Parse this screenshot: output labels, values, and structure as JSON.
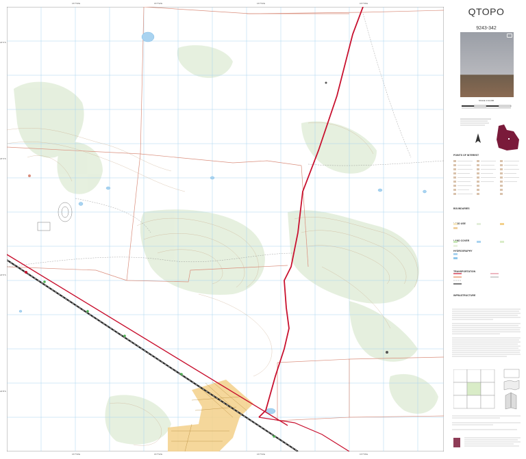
{
  "product_title": "QTOPO",
  "map_sheet_id": "9243-342",
  "scale_label": "SCALE 1:10,000",
  "sections": {
    "points_of_interest": "POINTS OF INTEREST",
    "boundaries": "BOUNDARIES",
    "land_use": "LAND USE",
    "land_cover": "LAND COVER",
    "hydrography": "HYDROGRAPHY",
    "transportation": "TRANSPORTATION",
    "infrastructure": "INFRASTRUCTURE"
  },
  "collar": {
    "top_ticks": [
      "157°50'E",
      "157°52'E",
      "157°54'E",
      "157°56'E"
    ],
    "bottom_ticks": [
      "157°50'E",
      "157°52'E",
      "157°54'E",
      "157°56'E"
    ],
    "left_ticks": [
      "24°2'S",
      "24°4'S",
      "24°6'S",
      "24°8'S"
    ]
  },
  "colors": {
    "main_road": "#c8102e",
    "railway": "#222222",
    "cadastre": "#d98c7a",
    "grid": "#a7d3ef",
    "water": "#a9d3f0",
    "vegetation": "#e3eedb",
    "urban": "#f3d08a",
    "state_fill": "#7a1a3a"
  },
  "icons": [
    "camera-icon",
    "locality-map-icon",
    "north-arrow-icon",
    "scale-bar-icon"
  ]
}
